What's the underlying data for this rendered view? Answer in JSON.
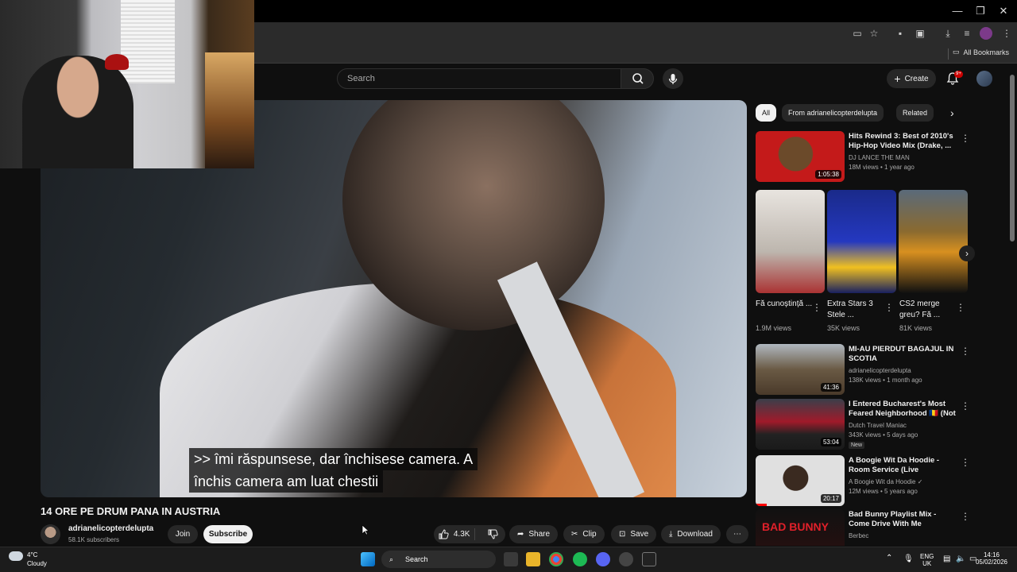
{
  "browser": {
    "bookmarks_label": "All Bookmarks",
    "window_controls": {
      "minimize": "—",
      "maximize": "❐",
      "close": "✕"
    }
  },
  "header": {
    "search_placeholder": "Search",
    "create_label": "Create",
    "notification_count": "9+"
  },
  "video": {
    "title": "14 ORE PE DRUM PANA IN AUSTRIA",
    "subtitle_line1": ">> îmi răspunsese, dar închisese camera. A",
    "subtitle_line2": "închis camera am luat chestii",
    "channel_name": "adrianelicopterdelupta",
    "channel_subs": "58.1K subscribers",
    "join_label": "Join",
    "subscribe_label": "Subscribe",
    "like_count": "4.3K",
    "share_label": "Share",
    "clip_label": "Clip",
    "save_label": "Save",
    "download_label": "Download"
  },
  "filters": {
    "chips": [
      "All",
      "From adrianelicopterdelupta",
      "Related"
    ]
  },
  "related": [
    {
      "title": "Hits Rewind 3: Best of 2010's Hip-Hop Video Mix (Drake, ...",
      "channel": "DJ LANCE THE MAN",
      "stats": "18M views • 1 year ago",
      "duration": "1:05:38",
      "thumb_color": "#c41a1a"
    },
    {
      "title": "MI-AU PIERDUT BAGAJUL IN SCOTIA",
      "channel": "adrianelicopterdelupta",
      "stats": "138K views • 1 month ago",
      "duration": "41:36",
      "thumb_color": "#6a5a44"
    },
    {
      "title": "I Entered Bucharest's Most Feared Neighborhood 🇷🇴 (Not ...",
      "channel": "Dutch Travel Maniac",
      "stats": "343K views • 5 days ago",
      "duration": "53:04",
      "badge": "New",
      "thumb_color": "#3a3f4a"
    },
    {
      "title": "A Boogie Wit Da Hoodie - Room Service (Live Performance)",
      "channel": "A Boogie Wit da Hoodie ✓",
      "stats": "12M views • 5 years ago",
      "duration": "20:17",
      "thumb_color": "#d8d8d8"
    },
    {
      "title": "Bad Bunny Playlist Mix - Come Drive With Me",
      "channel": "Berbec",
      "stats": "",
      "duration": "",
      "thumb_color": "#1a1a1a"
    }
  ],
  "shorts": [
    {
      "title": "Fă cunoștință ...",
      "views": "1.9M views"
    },
    {
      "title": "Extra Stars 3 Stele  ...",
      "views": "35K views"
    },
    {
      "title": "CS2 merge greu? Fă ...",
      "views": "81K views"
    }
  ],
  "taskbar": {
    "temperature": "4°C",
    "condition": "Cloudy",
    "search_label": "Search",
    "lang_top": "ENG",
    "lang_bottom": "UK",
    "time": "14:16",
    "date": "05/02/2026"
  }
}
